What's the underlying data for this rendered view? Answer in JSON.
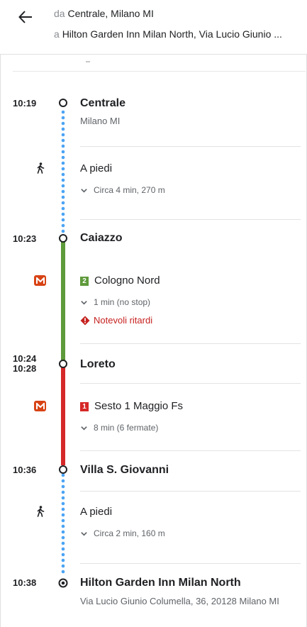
{
  "header": {
    "from_prefix": "da",
    "from_place": "Centrale, Milano MI",
    "to_prefix": "a",
    "to_place": "Hilton Garden Inn Milan North, Via Lucio Giunio ..."
  },
  "colors": {
    "walk": "#4aa3f4",
    "line_green": "#5e9a3a",
    "line_red": "#d62828",
    "metro_badge": "#d84315",
    "alert": "#c5221f"
  },
  "stops": [
    {
      "time": "10:19",
      "name": "Centrale",
      "sub": "Milano MI"
    },
    {
      "time": "10:23",
      "name": "Caiazzo"
    },
    {
      "time_arr": "10:24",
      "time_dep": "10:28",
      "name": "Loreto"
    },
    {
      "time": "10:36",
      "name": "Villa S. Giovanni"
    },
    {
      "time": "10:38",
      "name": "Hilton Garden Inn Milan North",
      "sub": "Via Lucio Giunio Columella, 36, 20128 Milano MI"
    }
  ],
  "legs": [
    {
      "type": "walk",
      "icon": "walking-person-icon",
      "label": "A piedi",
      "detail": "Circa 4 min, 270 m"
    },
    {
      "type": "metro",
      "icon": "metro-m-icon",
      "line_number": "2",
      "line_color": "#5e9a3a",
      "label": "Cologno Nord",
      "detail": "1 min (no stop)",
      "alert": "Notevoli ritardi"
    },
    {
      "type": "metro",
      "icon": "metro-m-icon",
      "line_number": "1",
      "line_color": "#d62828",
      "label": "Sesto 1 Maggio Fs",
      "detail": "8 min (6 fermate)"
    },
    {
      "type": "walk",
      "icon": "walking-person-icon",
      "label": "A piedi",
      "detail": "Circa 2 min, 160 m"
    }
  ]
}
